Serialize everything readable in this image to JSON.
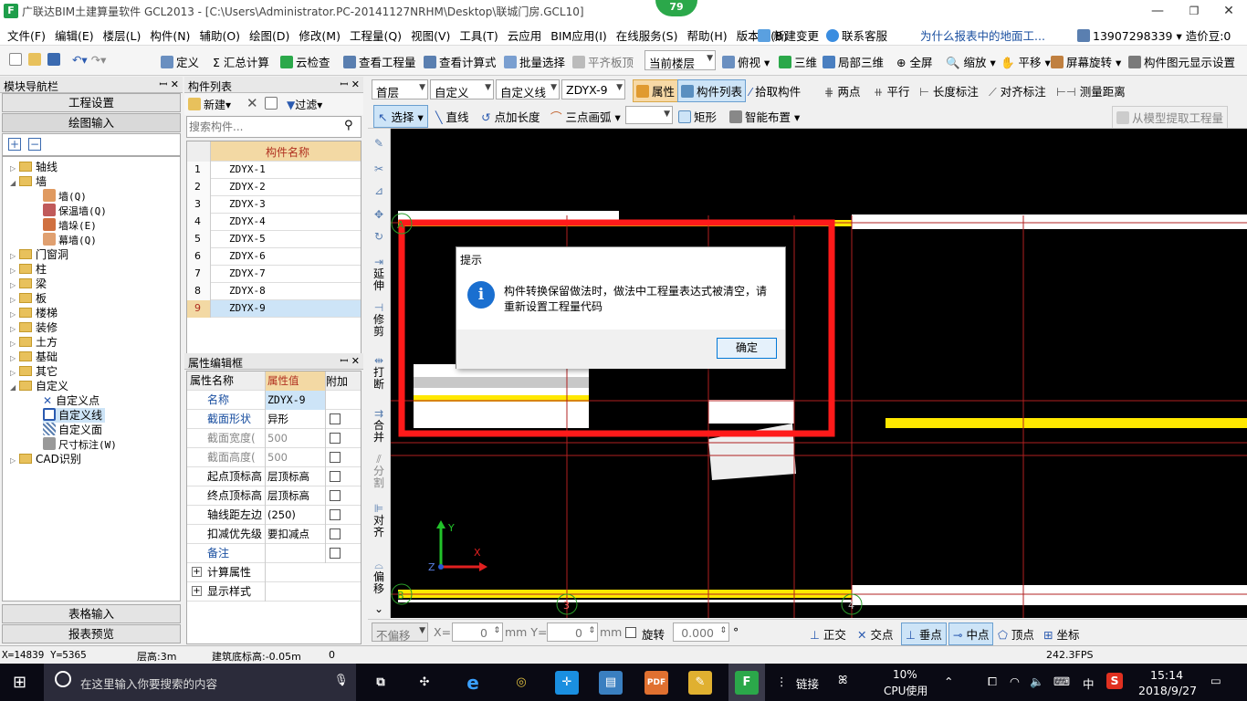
{
  "window": {
    "title": "广联达BIM土建算量软件 GCL2013 - [C:\\Users\\Administrator.PC-20141127NRHM\\Desktop\\联城门房.GCL10]",
    "badge": "79",
    "app_icon": "F"
  },
  "menubar": {
    "items": [
      "文件(F)",
      "编辑(E)",
      "楼层(L)",
      "构件(N)",
      "辅助(O)",
      "绘图(D)",
      "修改(M)",
      "工程量(Q)",
      "视图(V)",
      "工具(T)",
      "云应用",
      "BIM应用(I)",
      "在线服务(S)",
      "帮助(H)",
      "版本号(B)"
    ],
    "new_change": "新建变更",
    "contact": "联系客服",
    "question": "为什么报表中的地面工...",
    "phone": "13907298339",
    "beans": "造价豆:0"
  },
  "toolbar1": {
    "define": "定义",
    "summary_calc": "汇总计算",
    "cloud_check": "云检查",
    "view_qty": "查看工程量",
    "view_formula": "查看计算式",
    "batch_select": "批量选择",
    "flush_slab": "平齐板顶",
    "floor_combo": "当前楼层",
    "top_view": "俯视",
    "three_d": "三维",
    "local_3d": "局部三维",
    "fullscreen": "全屏",
    "zoom": "缩放",
    "pan": "平移",
    "rotate": "屏幕旋转",
    "element_display": "构件图元显示设置"
  },
  "nav_panel": {
    "title": "模块导航栏",
    "project_settings": "工程设置",
    "drawing_input": "绘图输入",
    "table_input": "表格输入",
    "report_preview": "报表预览",
    "tree": [
      {
        "label": "轴线",
        "level": 0,
        "expanded": false
      },
      {
        "label": "墙",
        "level": 0,
        "expanded": true
      },
      {
        "label": "墙(Q)",
        "level": 1
      },
      {
        "label": "保温墙(Q)",
        "level": 1
      },
      {
        "label": "墙垛(E)",
        "level": 1
      },
      {
        "label": "幕墙(Q)",
        "level": 1
      },
      {
        "label": "门窗洞",
        "level": 0,
        "expanded": false
      },
      {
        "label": "柱",
        "level": 0,
        "expanded": false
      },
      {
        "label": "梁",
        "level": 0,
        "expanded": false
      },
      {
        "label": "板",
        "level": 0,
        "expanded": false
      },
      {
        "label": "楼梯",
        "level": 0,
        "expanded": false
      },
      {
        "label": "装修",
        "level": 0,
        "expanded": false
      },
      {
        "label": "土方",
        "level": 0,
        "expanded": false
      },
      {
        "label": "基础",
        "level": 0,
        "expanded": false
      },
      {
        "label": "其它",
        "level": 0,
        "expanded": false
      },
      {
        "label": "自定义",
        "level": 0,
        "expanded": true
      },
      {
        "label": "自定义点",
        "level": 1
      },
      {
        "label": "自定义线",
        "level": 1,
        "selected": true
      },
      {
        "label": "自定义面",
        "level": 1
      },
      {
        "label": "尺寸标注(W)",
        "level": 1
      },
      {
        "label": "CAD识别",
        "level": 0,
        "expanded": false
      }
    ]
  },
  "component_list": {
    "title": "构件列表",
    "new_btn": "新建",
    "filter_btn": "过滤",
    "search_placeholder": "搜索构件...",
    "column": "构件名称",
    "rows": [
      "ZDYX-1",
      "ZDYX-2",
      "ZDYX-3",
      "ZDYX-4",
      "ZDYX-5",
      "ZDYX-6",
      "ZDYX-7",
      "ZDYX-8",
      "ZDYX-9"
    ],
    "selected_index": 8
  },
  "property_panel": {
    "title": "属性编辑框",
    "col_name": "属性名称",
    "col_value": "属性值",
    "col_extra": "附加",
    "rows": [
      {
        "name": "名称",
        "value": "ZDYX-9",
        "blue": true,
        "check": false
      },
      {
        "name": "截面形状",
        "value": "异形",
        "blue": true,
        "check": true
      },
      {
        "name": "截面宽度(",
        "value": "500",
        "gray": true,
        "check": true
      },
      {
        "name": "截面高度(",
        "value": "500",
        "gray": true,
        "check": true
      },
      {
        "name": "起点顶标高",
        "value": "层顶标高",
        "check": true
      },
      {
        "name": "终点顶标高",
        "value": "层顶标高",
        "check": true
      },
      {
        "name": "轴线距左边",
        "value": "(250)",
        "check": true
      },
      {
        "name": "扣减优先级",
        "value": "要扣减点",
        "check": true
      },
      {
        "name": "备注",
        "value": "",
        "blue": true,
        "check": true
      },
      {
        "name": "计算属性",
        "value": "",
        "group": true
      },
      {
        "name": "显示样式",
        "value": "",
        "group": true
      }
    ]
  },
  "draw_toolbar": {
    "floor": "首层",
    "category": "自定义",
    "type": "自定义线",
    "element": "ZDYX-9",
    "attribute": "属性",
    "component_list": "构件列表",
    "pick": "拾取构件",
    "two_point": "两点",
    "parallel": "平行",
    "length_dim": "长度标注",
    "align_dim": "对齐标注",
    "measure": "测量距离",
    "select": "选择",
    "line": "直线",
    "add_length": "点加长度",
    "arc": "三点画弧",
    "rect": "矩形",
    "smart": "智能布置",
    "extract": "从模型提取工程量"
  },
  "vertical_tools": [
    "延伸",
    "修剪",
    "打断",
    "合并",
    "分割",
    "对齐",
    "偏移"
  ],
  "dialog": {
    "title": "提示",
    "message": "构件转换保留做法时，做法中工程量表达式被清空，请重新设置工程量代码",
    "ok": "确定"
  },
  "axis_markers": {
    "a": "A",
    "b": "B",
    "c3": "3",
    "c4": "4",
    "x": "X",
    "y": "Y",
    "z": "Z"
  },
  "snap_bar": {
    "no_offset": "不偏移",
    "x_label": "X=",
    "x_value": "0",
    "y_label": "mm Y=",
    "y_value": "0",
    "mm": "mm",
    "rotate": "旋转",
    "rotate_value": "0.000",
    "degree": "°",
    "ortho": "正交",
    "intersection": "交点",
    "perpendicular": "垂点",
    "midpoint": "中点",
    "vertex": "顶点",
    "coord": "坐标"
  },
  "status_bar": {
    "coords": "X=14839 Y=5365",
    "floor_height": "层高:3m",
    "base_elev": "建筑底标高:-0.05m",
    "zero": "0",
    "fps": "242.3FPS"
  },
  "taskbar": {
    "search": "在这里输入你要搜索的内容",
    "link": "链接",
    "cpu_pct": "10%",
    "cpu_label": "CPU使用",
    "ime": "中",
    "time": "15:14",
    "date": "2018/9/27"
  },
  "colors": {
    "accent_green": "#2ba84a",
    "highlight_red": "#ff1a1a",
    "wall_yellow": "#ffe800",
    "canvas": "#000000",
    "taskbar": "#0a0a14"
  }
}
